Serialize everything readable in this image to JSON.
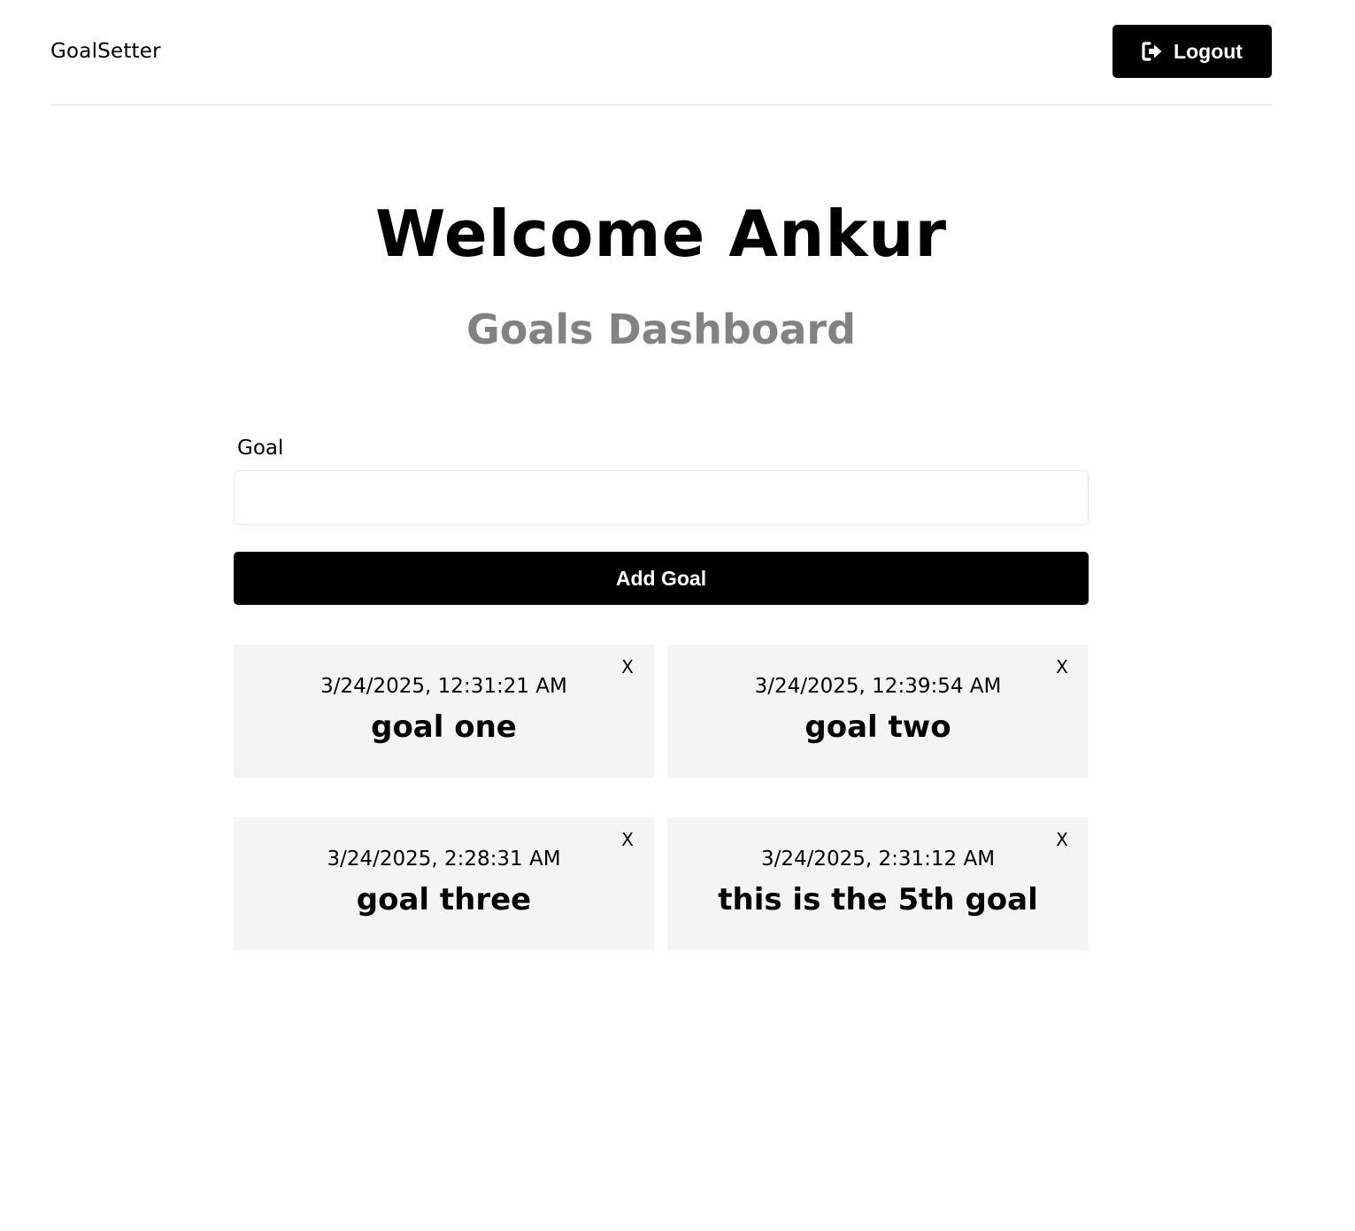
{
  "header": {
    "logo": "GoalSetter",
    "logout_label": "Logout"
  },
  "main": {
    "heading": "Welcome Ankur",
    "subheading": "Goals Dashboard"
  },
  "form": {
    "label": "Goal",
    "input_value": "",
    "submit_label": "Add Goal"
  },
  "goals": [
    {
      "date": "3/24/2025, 12:31:21 AM",
      "text": "goal one",
      "close": "X"
    },
    {
      "date": "3/24/2025, 12:39:54 AM",
      "text": "goal two",
      "close": "X"
    },
    {
      "date": "3/24/2025, 2:28:31 AM",
      "text": "goal three",
      "close": "X"
    },
    {
      "date": "3/24/2025, 2:31:12 AM",
      "text": "this is the 5th goal",
      "close": "X"
    }
  ]
}
